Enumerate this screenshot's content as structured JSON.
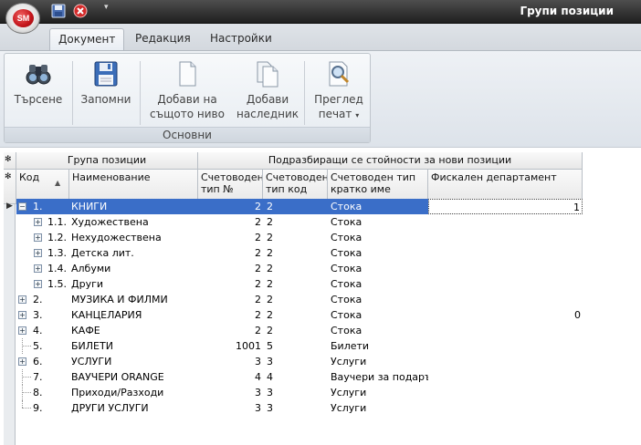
{
  "window": {
    "title": "Групи позиции",
    "app_logo": "SM"
  },
  "quick_access": {
    "save_icon": "floppy-icon",
    "close_icon": "close-circle-icon",
    "dropdown_icon": "chevron-down-icon"
  },
  "ribbon": {
    "tabs": [
      {
        "label": "Документ",
        "active": true
      },
      {
        "label": "Редакция",
        "active": false
      },
      {
        "label": "Настройки",
        "active": false
      }
    ],
    "group_label": "Основни",
    "buttons": {
      "search": {
        "line1": "Търсене",
        "line2": "",
        "icon": "binoculars-icon"
      },
      "save": {
        "line1": "Запомни",
        "line2": "",
        "icon": "floppy-icon"
      },
      "add_same": {
        "line1": "Добави на",
        "line2": "същото ниво",
        "icon": "document-icon"
      },
      "add_child": {
        "line1": "Добави",
        "line2": "наследник",
        "icon": "documents-icon"
      },
      "preview": {
        "line1": "Преглед",
        "line2": "печат",
        "icon": "print-preview-icon",
        "dropdown": "▾"
      }
    }
  },
  "grid": {
    "band_left": "Група позиции",
    "band_right": "Подразбиращи се стойности за нови позиции",
    "columns": {
      "code": "Код",
      "name": "Наименование",
      "tipno": "Счетоводен тип №",
      "tipcode": "Счетоводен тип код",
      "type": "Счетоводен тип кратко име",
      "fiscal": "Фискален департамент"
    },
    "rows": [
      {
        "code": "1.",
        "name": "КНИГИ",
        "tipno": "2",
        "tipcode": "2",
        "type": "Стока",
        "fiscal": "1",
        "level": 0,
        "expander": "−",
        "selected": true
      },
      {
        "code": "1.1.",
        "name": "Художествена",
        "tipno": "2",
        "tipcode": "2",
        "type": "Стока",
        "fiscal": "",
        "level": 1,
        "expander": "+"
      },
      {
        "code": "1.2.",
        "name": "Нехудожествена",
        "tipno": "2",
        "tipcode": "2",
        "type": "Стока",
        "fiscal": "",
        "level": 1,
        "expander": "+"
      },
      {
        "code": "1.3.",
        "name": "Детска лит.",
        "tipno": "2",
        "tipcode": "2",
        "type": "Стока",
        "fiscal": "",
        "level": 1,
        "expander": "+"
      },
      {
        "code": "1.4.",
        "name": "Албуми",
        "tipno": "2",
        "tipcode": "2",
        "type": "Стока",
        "fiscal": "",
        "level": 1,
        "expander": "+"
      },
      {
        "code": "1.5.",
        "name": "Други",
        "tipno": "2",
        "tipcode": "2",
        "type": "Стока",
        "fiscal": "",
        "level": 1,
        "expander": "+"
      },
      {
        "code": "2.",
        "name": "МУЗИКА И ФИЛМИ",
        "tipno": "2",
        "tipcode": "2",
        "type": "Стока",
        "fiscal": "",
        "level": 0,
        "expander": "+"
      },
      {
        "code": "3.",
        "name": "КАНЦЕЛАРИЯ",
        "tipno": "2",
        "tipcode": "2",
        "type": "Стока",
        "fiscal": "0",
        "level": 0,
        "expander": "+"
      },
      {
        "code": "4.",
        "name": "КАФЕ",
        "tipno": "2",
        "tipcode": "2",
        "type": "Стока",
        "fiscal": "",
        "level": 0,
        "expander": "+"
      },
      {
        "code": "5.",
        "name": "БИЛЕТИ",
        "tipno": "1001",
        "tipcode": "5",
        "type": "Билети",
        "fiscal": "",
        "level": 0,
        "expander": ""
      },
      {
        "code": "6.",
        "name": "УСЛУГИ",
        "tipno": "3",
        "tipcode": "3",
        "type": "Услуги",
        "fiscal": "",
        "level": 0,
        "expander": "+"
      },
      {
        "code": "7.",
        "name": "ВАУЧЕРИ ORANGE",
        "tipno": "4",
        "tipcode": "4",
        "type": "Ваучери за подарък",
        "fiscal": "",
        "level": 0,
        "expander": ""
      },
      {
        "code": "8.",
        "name": "Приходи/Разходи",
        "tipno": "3",
        "tipcode": "3",
        "type": "Услуги",
        "fiscal": "",
        "level": 0,
        "expander": ""
      },
      {
        "code": "9.",
        "name": "ДРУГИ УСЛУГИ",
        "tipno": "3",
        "tipcode": "3",
        "type": "Услуги",
        "fiscal": "",
        "level": 0,
        "expander": ""
      }
    ]
  }
}
